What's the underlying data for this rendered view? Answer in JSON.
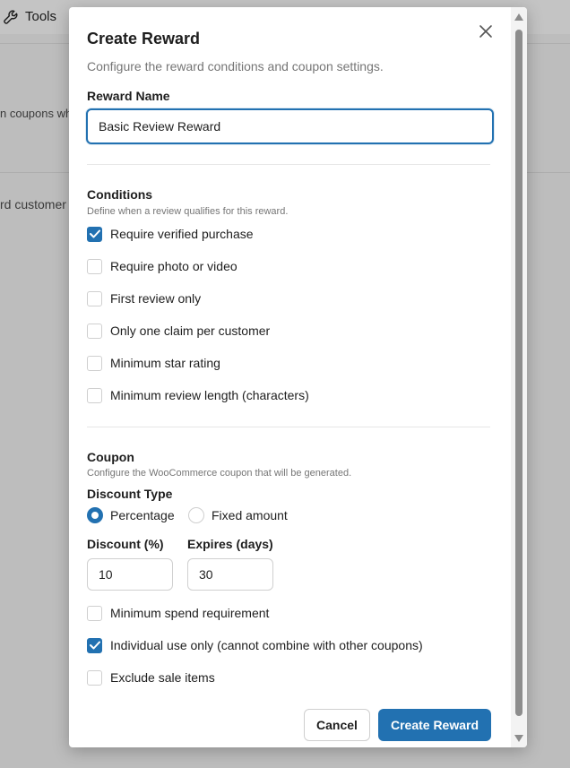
{
  "background": {
    "tools_label": "Tools",
    "text_1": "n coupons wh",
    "text_2": "rd customer"
  },
  "modal": {
    "title": "Create Reward",
    "subtitle": "Configure the reward conditions and coupon settings.",
    "reward_name_label": "Reward Name",
    "reward_name_value": "Basic Review Reward",
    "conditions": {
      "title": "Conditions",
      "description": "Define when a review qualifies for this reward.",
      "items": [
        {
          "label": "Require verified purchase",
          "checked": true
        },
        {
          "label": "Require photo or video",
          "checked": false
        },
        {
          "label": "First review only",
          "checked": false
        },
        {
          "label": "Only one claim per customer",
          "checked": false
        },
        {
          "label": "Minimum star rating",
          "checked": false
        },
        {
          "label": "Minimum review length (characters)",
          "checked": false
        }
      ]
    },
    "coupon": {
      "title": "Coupon",
      "description": "Configure the WooCommerce coupon that will be generated.",
      "discount_type_label": "Discount Type",
      "discount_types": [
        {
          "label": "Percentage",
          "selected": true
        },
        {
          "label": "Fixed amount",
          "selected": false
        }
      ],
      "discount_label": "Discount (%)",
      "discount_value": "10",
      "expires_label": "Expires (days)",
      "expires_value": "30",
      "options": [
        {
          "label": "Minimum spend requirement",
          "checked": false
        },
        {
          "label": "Individual use only (cannot combine with other coupons)",
          "checked": true
        },
        {
          "label": "Exclude sale items",
          "checked": false
        }
      ]
    },
    "cancel_label": "Cancel",
    "submit_label": "Create Reward"
  },
  "colors": {
    "accent": "#2271b1",
    "overlay": "#bdbdbd",
    "muted_text": "#757575"
  },
  "icons": {
    "tools": "wrench-icon",
    "close": "close-icon",
    "check": "checkmark-icon",
    "scroll_up": "triangle-up-icon",
    "scroll_down": "triangle-down-icon"
  }
}
